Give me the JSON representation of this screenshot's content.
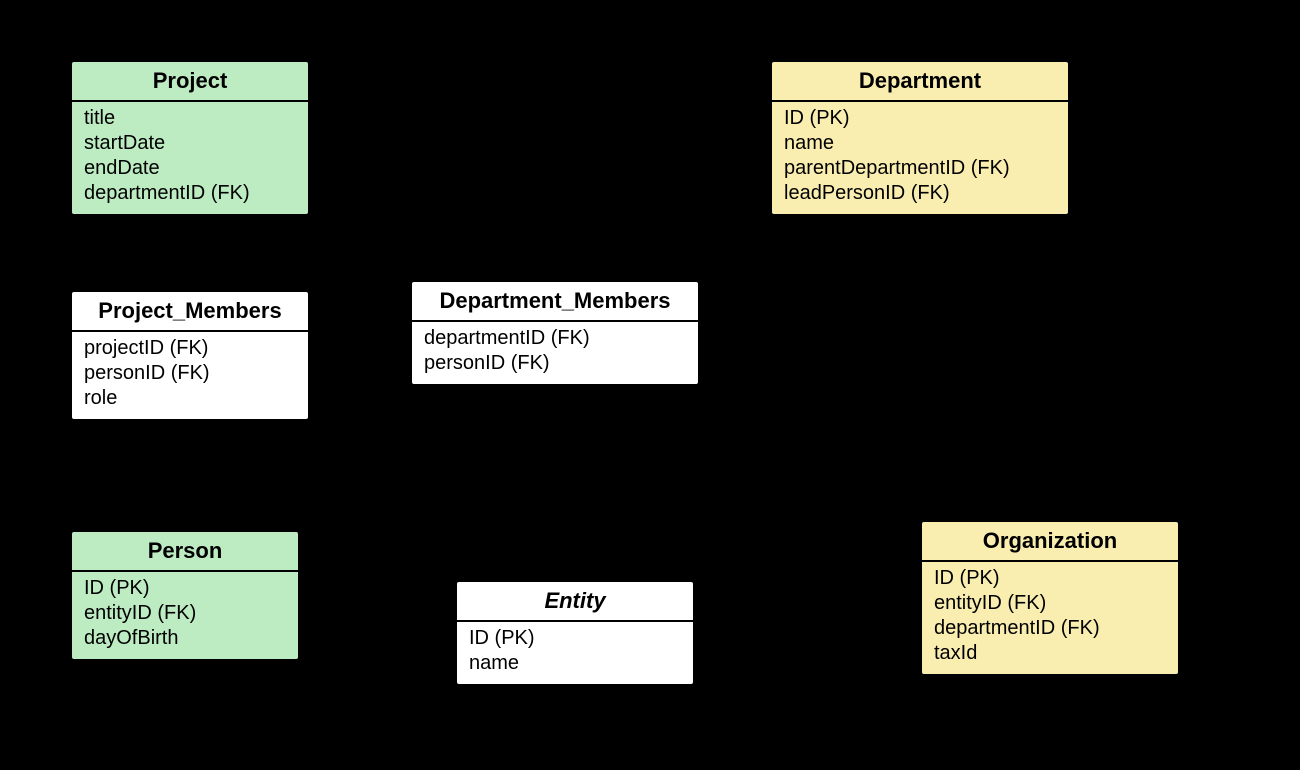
{
  "diagram": {
    "type": "er-diagram",
    "entities": {
      "project": {
        "name": "Project",
        "fill": "green",
        "attrs": [
          "title",
          "startDate",
          "endDate",
          "departmentID (FK)"
        ]
      },
      "department": {
        "name": "Department",
        "fill": "yellow",
        "attrs": [
          "ID (PK)",
          "name",
          "parentDepartmentID (FK)",
          "leadPersonID (FK)"
        ]
      },
      "project_members": {
        "name": "Project_Members",
        "fill": "white",
        "attrs": [
          "projectID (FK)",
          "personID (FK)",
          "role"
        ]
      },
      "department_members": {
        "name": "Department_Members",
        "fill": "white",
        "attrs": [
          "departmentID (FK)",
          "personID (FK)"
        ]
      },
      "person": {
        "name": "Person",
        "fill": "green",
        "attrs": [
          "ID (PK)",
          "entityID (FK)",
          "dayOfBirth"
        ]
      },
      "entity": {
        "name": "Entity",
        "fill": "white",
        "italic_title": true,
        "attrs": [
          "ID (PK)",
          "name"
        ]
      },
      "organization": {
        "name": "Organization",
        "fill": "yellow",
        "attrs": [
          "ID (PK)",
          "entityID (FK)",
          "departmentID (FK)",
          "taxId"
        ]
      }
    }
  }
}
